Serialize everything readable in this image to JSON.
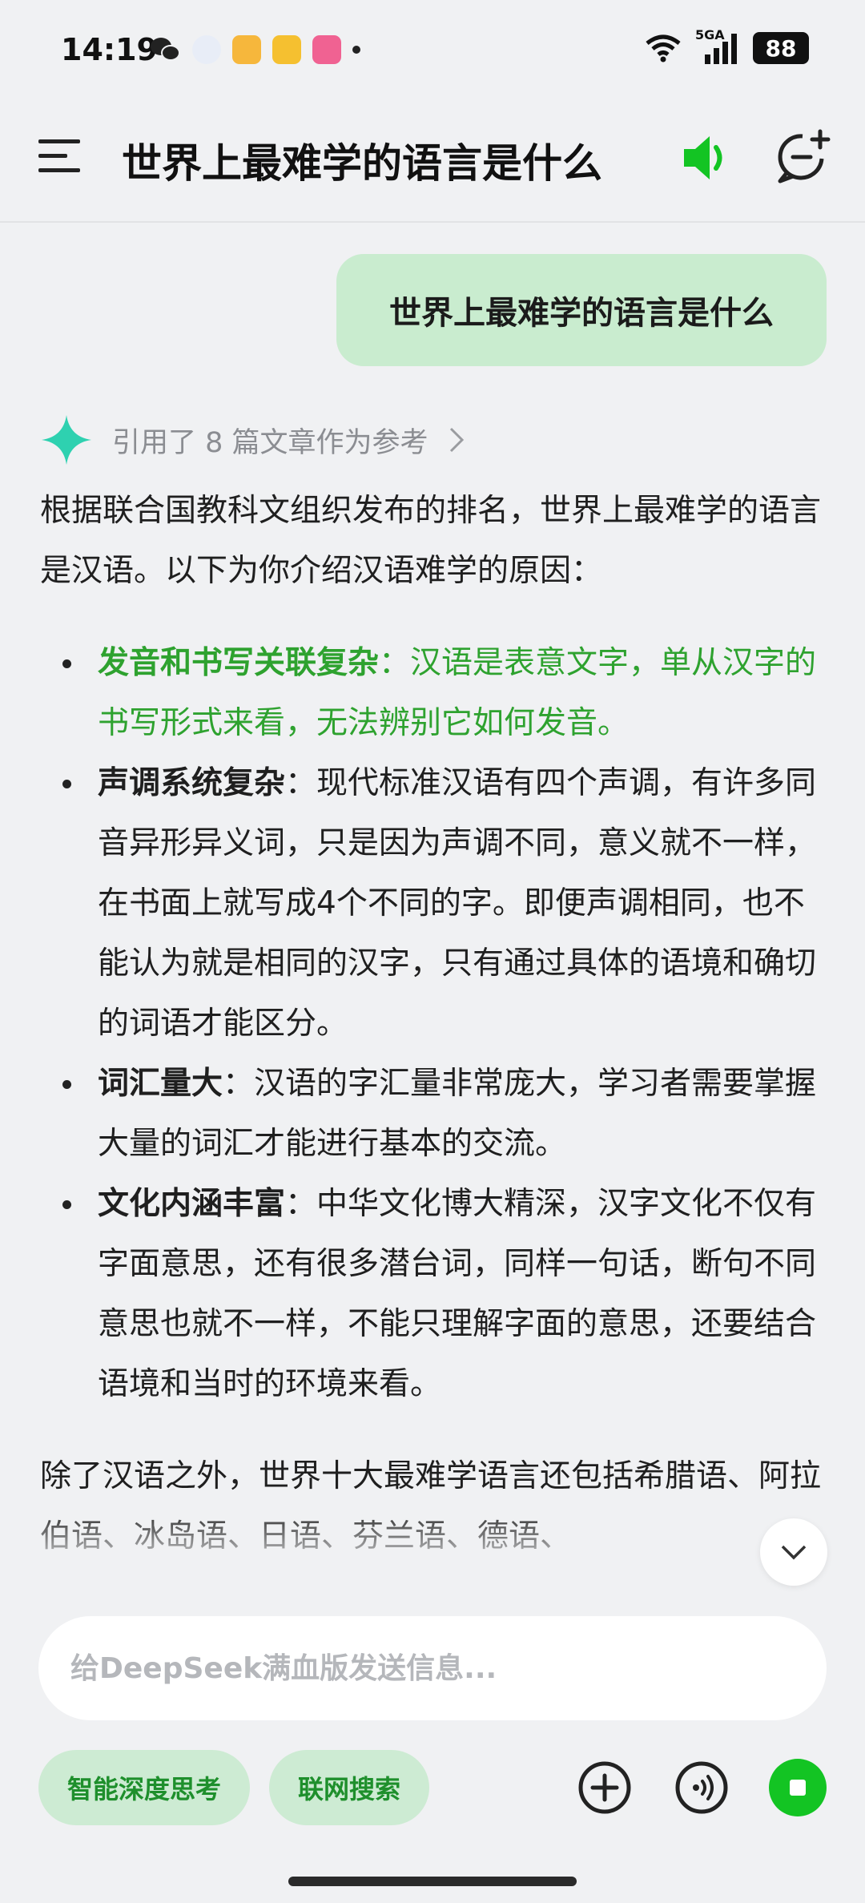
{
  "status_bar": {
    "time": "14:19",
    "network": "5GA",
    "battery": "88"
  },
  "header": {
    "title": "世界上最难学的语言是什么"
  },
  "user_message": {
    "text": "世界上最难学的语言是什么"
  },
  "answer": {
    "references_label": "引用了 8 篇文章作为参考",
    "intro": "根据联合国教科文组织发布的排名，世界上最难学的语言是汉语。以下为你介绍汉语难学的原因：",
    "points": [
      {
        "term": "发音和书写关联复杂",
        "desc": "：汉语是表意文字，单从汉字的书写形式来看，无法辨别它如何发音。"
      },
      {
        "term": "声调系统复杂",
        "desc": "：现代标准汉语有四个声调，有许多同音异形异义词，只是因为声调不同，意义就不一样，在书面上就写成4个不同的字。即便声调相同，也不能认为就是相同的汉字，只有通过具体的语境和确切的词语才能区分。"
      },
      {
        "term": "词汇量大",
        "desc": "：汉语的字汇量非常庞大，学习者需要掌握大量的词汇才能进行基本的交流。"
      },
      {
        "term": "文化内涵丰富",
        "desc": "：中华文化博大精深，汉字文化不仅有字面意思，还有很多潜台词，同样一句话，断句不同意思也就不一样，不能只理解字面的意思，还要结合语境和当时的环境来看。"
      }
    ],
    "tail": "除了汉语之外，世界十大最难学语言还包括希腊语、阿拉伯语、冰岛语、日语、芬兰语、德语、"
  },
  "composer": {
    "placeholder": "给DeepSeek满血版发送信息...",
    "deep_think_label": "智能深度思考",
    "web_search_label": "联网搜索"
  },
  "colors": {
    "accent_green": "#13c423",
    "highlight_text": "#2ea22f",
    "user_bubble": "#c9eccf",
    "chip_bg": "#cdebd3",
    "background": "#f0f1f3"
  },
  "icons": {
    "menu": "menu-icon",
    "speaker": "speaker-icon",
    "new_chat": "new-chat-icon",
    "logo": "sparkle-logo-icon",
    "chevron": "chevron-right-icon",
    "scroll_down": "chevron-down-icon",
    "plus": "plus-circle-icon",
    "voice": "voice-icon",
    "stop": "stop-icon"
  }
}
